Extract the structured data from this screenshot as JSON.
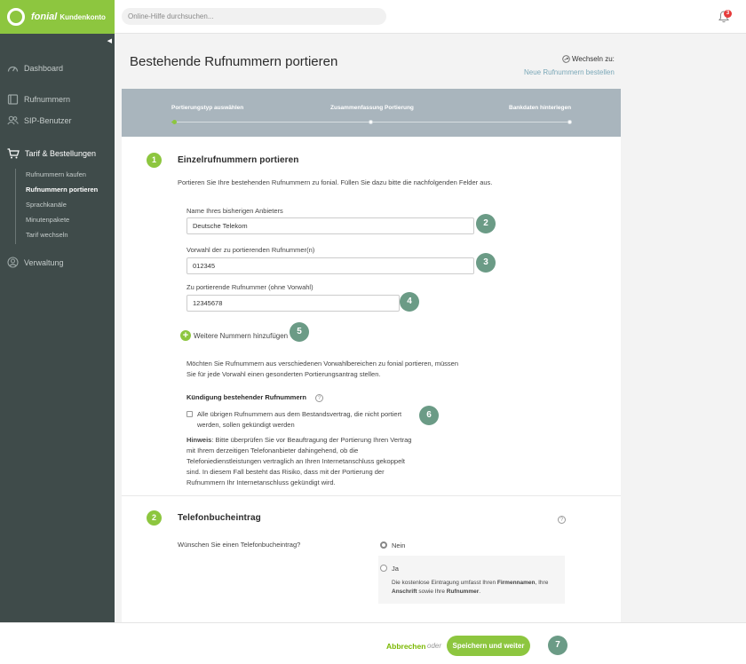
{
  "brand": {
    "name": "fonial",
    "subtitle": "Kundenkonto",
    "color": "#8dc63f"
  },
  "topbar": {
    "search_placeholder": "Online-Hilfe durchsuchen...",
    "notification_count": "3"
  },
  "sidebar": {
    "collapse_glyph": "◀",
    "items": [
      {
        "label": "Dashboard",
        "icon": "dashboard-icon"
      },
      {
        "label": "Rufnummern",
        "icon": "book-icon"
      },
      {
        "label": "SIP-Benutzer",
        "icon": "users-icon"
      },
      {
        "label": "Tarif & Bestellungen",
        "icon": "cart-icon"
      },
      {
        "label": "Verwaltung",
        "icon": "user-circle-icon"
      }
    ],
    "subitems": [
      "Rufnummern kaufen",
      "Rufnummern portieren",
      "Sprachkanäle",
      "Minutenpakete",
      "Tarif wechseln"
    ]
  },
  "page": {
    "title": "Bestehende Rufnummern portieren",
    "switch_label": "Wechseln zu:",
    "switch_link": "Neue Rufnummern bestellen"
  },
  "stepper": {
    "steps": [
      "Portierungstyp auswählen",
      "Zusammenfassung Portierung",
      "Bankdaten hinterlegen"
    ],
    "current_step": 1
  },
  "section1": {
    "number": "1",
    "title": "Einzelrufnummern portieren",
    "intro": "Portieren Sie Ihre bestehenden Rufnummern zu fonial. Füllen Sie dazu bitte die nachfolgenden Felder aus.",
    "provider_label": "Name Ihres bisherigen Anbieters",
    "provider_value": "Deutsche Telekom",
    "area_code_label": "Vorwahl der zu portierenden Rufnummer(n)",
    "area_code_value": "012345",
    "number_label": "Zu portierende Rufnummer (ohne Vorwahl)",
    "number_value": "12345678",
    "add_more": "Weitere Nummern hinzufügen",
    "add_more_glyph": "+",
    "note_line1": "Möchten Sie Rufnummern aus verschiedenen Vorwahlbereichen zu fonial portieren, müssen",
    "note_line2": "Sie für jede Vorwahl einen gesonderten Portierungsantrag stellen.",
    "cancellation_title": "Kündigung bestehender Rufnummern",
    "help_glyph": "?",
    "checkbox_line1": "Alle übrigen Rufnummern aus dem Bestandsvertrag, die nicht portiert",
    "checkbox_line2": "werden, sollen gekündigt werden",
    "hint_label": "Hinweis",
    "hint_line1": ": Bitte überprüfen Sie vor Beauftragung der Portierung Ihren Vertrag",
    "hint_line2": "mit Ihrem derzeitigen Telefonanbieter dahingehend, ob die",
    "hint_line3": "Telefoniedienstleistungen vertraglich an Ihren Internetanschluss gekoppelt",
    "hint_line4": "sind. In diesem Fall besteht das Risiko, dass mit der Portierung der",
    "hint_line5": "Rufnummern Ihr Internetanschluss gekündigt wird."
  },
  "section2": {
    "number": "2",
    "title": "Telefonbucheintrag",
    "help_glyph": "?",
    "question": "Wünschen Sie einen Telefonbucheintrag?",
    "option_no": "Nein",
    "option_yes": "Ja",
    "info_part1": "Die kostenlose Eintragung umfasst Ihren ",
    "info_bold1": "Firmennamen",
    "info_part2": ", Ihre",
    "info_bold2": "Anschrift",
    "info_part3": " sowie Ihre ",
    "info_bold3": "Rufnummer",
    "info_part4": "."
  },
  "annotations": [
    "2",
    "3",
    "4",
    "5",
    "6",
    "7"
  ],
  "footer": {
    "cancel": "Abbrechen",
    "or": "oder",
    "save": "Speichern und weiter"
  }
}
